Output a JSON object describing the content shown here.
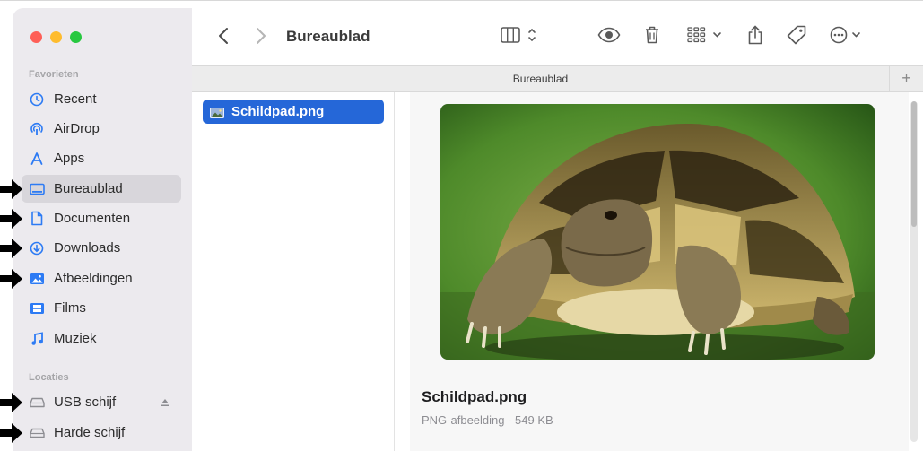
{
  "window": {
    "title": "Bureaublad",
    "tab_label": "Bureaublad"
  },
  "sidebar": {
    "favorites_label": "Favorieten",
    "locations_label": "Locaties",
    "favorites": [
      {
        "label": "Recent",
        "icon": "clock-icon"
      },
      {
        "label": "AirDrop",
        "icon": "airdrop-icon"
      },
      {
        "label": "Apps",
        "icon": "apps-icon"
      },
      {
        "label": "Bureaublad",
        "icon": "desktop-icon",
        "selected": true
      },
      {
        "label": "Documenten",
        "icon": "document-icon"
      },
      {
        "label": "Downloads",
        "icon": "download-icon"
      },
      {
        "label": "Afbeeldingen",
        "icon": "image-icon"
      },
      {
        "label": "Films",
        "icon": "film-icon"
      },
      {
        "label": "Muziek",
        "icon": "music-icon"
      }
    ],
    "locations": [
      {
        "label": "USB schijf",
        "icon": "drive-icon",
        "ejectable": true
      },
      {
        "label": "Harde schijf",
        "icon": "drive-icon"
      }
    ]
  },
  "files": [
    {
      "name": "Schildpad.png",
      "selected": true
    }
  ],
  "preview": {
    "name": "Schildpad.png",
    "meta": "PNG-afbeelding - 549 KB"
  },
  "colors": {
    "accent": "#2567d8",
    "sidebar_bg": "#eceaee"
  }
}
